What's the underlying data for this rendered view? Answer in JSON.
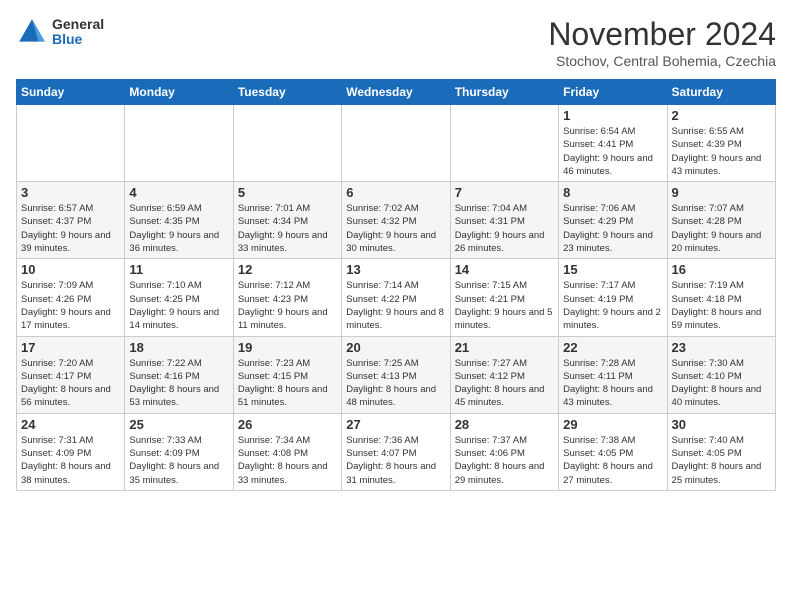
{
  "logo": {
    "general": "General",
    "blue": "Blue"
  },
  "title": "November 2024",
  "location": "Stochov, Central Bohemia, Czechia",
  "days_header": [
    "Sunday",
    "Monday",
    "Tuesday",
    "Wednesday",
    "Thursday",
    "Friday",
    "Saturday"
  ],
  "weeks": [
    [
      {
        "day": "",
        "info": ""
      },
      {
        "day": "",
        "info": ""
      },
      {
        "day": "",
        "info": ""
      },
      {
        "day": "",
        "info": ""
      },
      {
        "day": "",
        "info": ""
      },
      {
        "day": "1",
        "info": "Sunrise: 6:54 AM\nSunset: 4:41 PM\nDaylight: 9 hours and 46 minutes."
      },
      {
        "day": "2",
        "info": "Sunrise: 6:55 AM\nSunset: 4:39 PM\nDaylight: 9 hours and 43 minutes."
      }
    ],
    [
      {
        "day": "3",
        "info": "Sunrise: 6:57 AM\nSunset: 4:37 PM\nDaylight: 9 hours and 39 minutes."
      },
      {
        "day": "4",
        "info": "Sunrise: 6:59 AM\nSunset: 4:35 PM\nDaylight: 9 hours and 36 minutes."
      },
      {
        "day": "5",
        "info": "Sunrise: 7:01 AM\nSunset: 4:34 PM\nDaylight: 9 hours and 33 minutes."
      },
      {
        "day": "6",
        "info": "Sunrise: 7:02 AM\nSunset: 4:32 PM\nDaylight: 9 hours and 30 minutes."
      },
      {
        "day": "7",
        "info": "Sunrise: 7:04 AM\nSunset: 4:31 PM\nDaylight: 9 hours and 26 minutes."
      },
      {
        "day": "8",
        "info": "Sunrise: 7:06 AM\nSunset: 4:29 PM\nDaylight: 9 hours and 23 minutes."
      },
      {
        "day": "9",
        "info": "Sunrise: 7:07 AM\nSunset: 4:28 PM\nDaylight: 9 hours and 20 minutes."
      }
    ],
    [
      {
        "day": "10",
        "info": "Sunrise: 7:09 AM\nSunset: 4:26 PM\nDaylight: 9 hours and 17 minutes."
      },
      {
        "day": "11",
        "info": "Sunrise: 7:10 AM\nSunset: 4:25 PM\nDaylight: 9 hours and 14 minutes."
      },
      {
        "day": "12",
        "info": "Sunrise: 7:12 AM\nSunset: 4:23 PM\nDaylight: 9 hours and 11 minutes."
      },
      {
        "day": "13",
        "info": "Sunrise: 7:14 AM\nSunset: 4:22 PM\nDaylight: 9 hours and 8 minutes."
      },
      {
        "day": "14",
        "info": "Sunrise: 7:15 AM\nSunset: 4:21 PM\nDaylight: 9 hours and 5 minutes."
      },
      {
        "day": "15",
        "info": "Sunrise: 7:17 AM\nSunset: 4:19 PM\nDaylight: 9 hours and 2 minutes."
      },
      {
        "day": "16",
        "info": "Sunrise: 7:19 AM\nSunset: 4:18 PM\nDaylight: 8 hours and 59 minutes."
      }
    ],
    [
      {
        "day": "17",
        "info": "Sunrise: 7:20 AM\nSunset: 4:17 PM\nDaylight: 8 hours and 56 minutes."
      },
      {
        "day": "18",
        "info": "Sunrise: 7:22 AM\nSunset: 4:16 PM\nDaylight: 8 hours and 53 minutes."
      },
      {
        "day": "19",
        "info": "Sunrise: 7:23 AM\nSunset: 4:15 PM\nDaylight: 8 hours and 51 minutes."
      },
      {
        "day": "20",
        "info": "Sunrise: 7:25 AM\nSunset: 4:13 PM\nDaylight: 8 hours and 48 minutes."
      },
      {
        "day": "21",
        "info": "Sunrise: 7:27 AM\nSunset: 4:12 PM\nDaylight: 8 hours and 45 minutes."
      },
      {
        "day": "22",
        "info": "Sunrise: 7:28 AM\nSunset: 4:11 PM\nDaylight: 8 hours and 43 minutes."
      },
      {
        "day": "23",
        "info": "Sunrise: 7:30 AM\nSunset: 4:10 PM\nDaylight: 8 hours and 40 minutes."
      }
    ],
    [
      {
        "day": "24",
        "info": "Sunrise: 7:31 AM\nSunset: 4:09 PM\nDaylight: 8 hours and 38 minutes."
      },
      {
        "day": "25",
        "info": "Sunrise: 7:33 AM\nSunset: 4:09 PM\nDaylight: 8 hours and 35 minutes."
      },
      {
        "day": "26",
        "info": "Sunrise: 7:34 AM\nSunset: 4:08 PM\nDaylight: 8 hours and 33 minutes."
      },
      {
        "day": "27",
        "info": "Sunrise: 7:36 AM\nSunset: 4:07 PM\nDaylight: 8 hours and 31 minutes."
      },
      {
        "day": "28",
        "info": "Sunrise: 7:37 AM\nSunset: 4:06 PM\nDaylight: 8 hours and 29 minutes."
      },
      {
        "day": "29",
        "info": "Sunrise: 7:38 AM\nSunset: 4:05 PM\nDaylight: 8 hours and 27 minutes."
      },
      {
        "day": "30",
        "info": "Sunrise: 7:40 AM\nSunset: 4:05 PM\nDaylight: 8 hours and 25 minutes."
      }
    ]
  ]
}
